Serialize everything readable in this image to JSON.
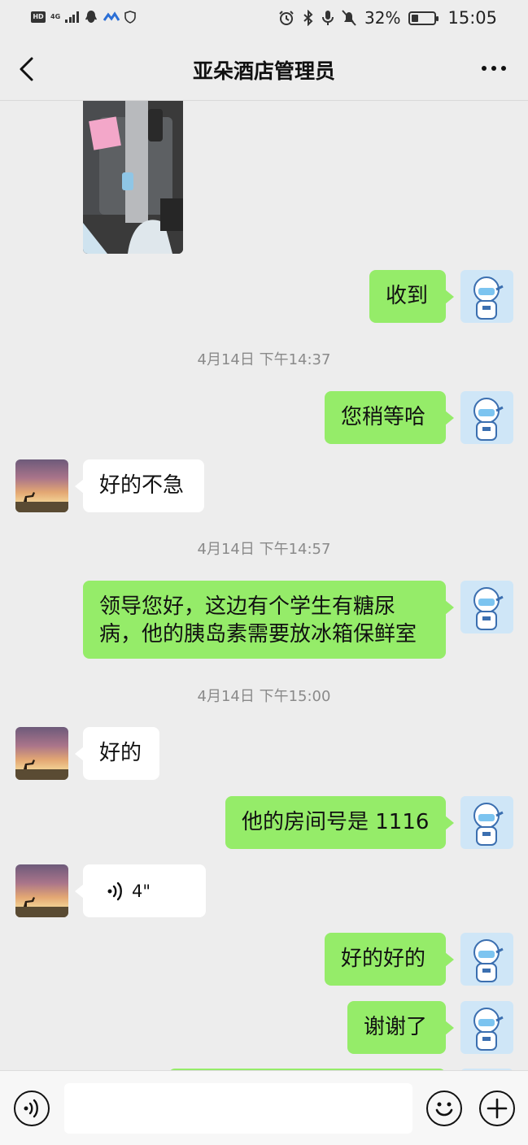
{
  "status_bar": {
    "hd": "HD",
    "network": "4G",
    "battery_percent": "32%",
    "battery_level": 0.32,
    "time": "15:05"
  },
  "header": {
    "title": "亚朵酒店管理员"
  },
  "messages": {
    "m1": "收到",
    "t1": "4月14日 下午14:37",
    "m2": "您稍等哈",
    "m3": "好的不急",
    "t2": "4月14日 下午14:57",
    "m4_line1": "领导您好，这边有个学生有糖尿",
    "m4_line2": "病，他的胰岛素需要放冰箱保鲜室",
    "t3": "4月14日 下午15:00",
    "m5": "好的",
    "m6": "他的房间号是 1116",
    "voice_duration": "4\"",
    "m7": "好的好的",
    "m8": "谢谢了"
  },
  "icons": {
    "back": "chevron-left-icon",
    "more": "more-dots-icon",
    "voice": "voice-input-icon",
    "emoji": "emoji-icon",
    "plus": "plus-icon"
  },
  "colors": {
    "my_bubble": "#95ec69",
    "other_bubble": "#ffffff",
    "background": "#ededed"
  }
}
